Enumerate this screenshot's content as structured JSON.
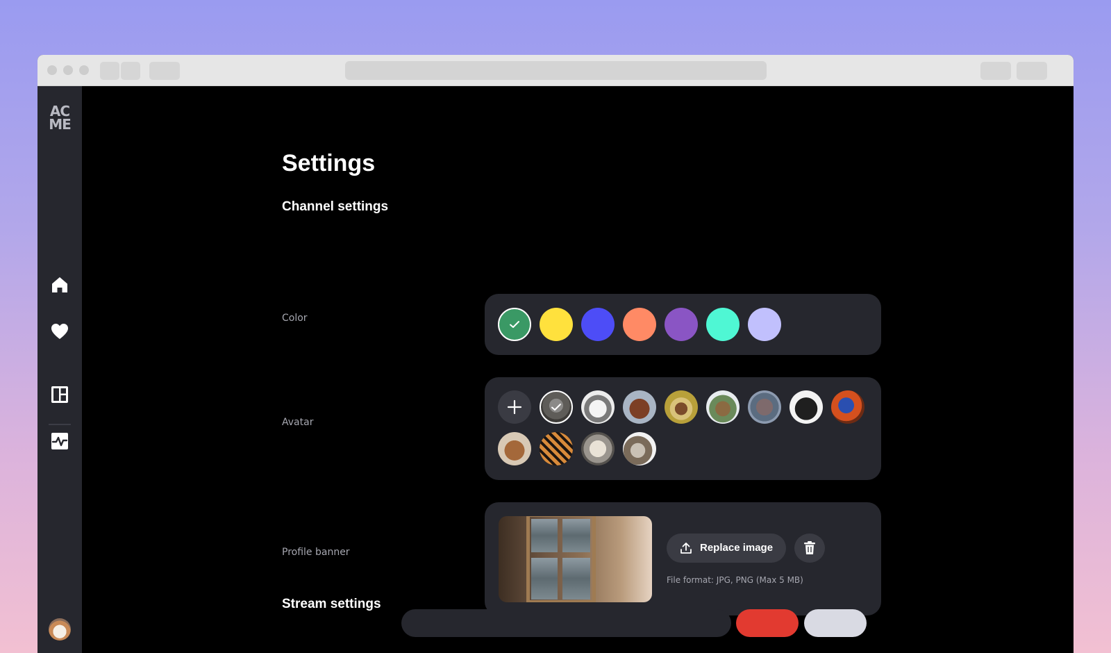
{
  "app": {
    "logo_line1": "AC",
    "logo_line2": "ME"
  },
  "sidebar": {
    "items": [
      {
        "name": "home",
        "icon": "home-icon"
      },
      {
        "name": "favorites",
        "icon": "heart-icon"
      },
      {
        "name": "dashboard",
        "icon": "dashboard-icon"
      },
      {
        "name": "activity",
        "icon": "activity-icon"
      }
    ],
    "user_avatar": "dog-avatar"
  },
  "page": {
    "title": "Settings"
  },
  "channel_settings": {
    "title": "Channel settings",
    "color": {
      "label": "Color",
      "options": [
        "#3a9965",
        "#ffe13d",
        "#4d4df7",
        "#ff8a65",
        "#8a55c4",
        "#4ff7d4",
        "#c1c0fd"
      ],
      "selected_index": 0
    },
    "avatar": {
      "label": "Avatar",
      "options": [
        "cat",
        "dog",
        "horse",
        "antelope",
        "giraffe",
        "hippo",
        "pug",
        "parrot",
        "bear",
        "tiger",
        "sheep",
        "hedgehog"
      ],
      "selected": "cat",
      "add_icon": "plus-icon"
    },
    "profile_banner": {
      "label": "Profile banner",
      "replace_label": "Replace image",
      "file_hint": "File format: JPG, PNG (Max 5 MB)",
      "upload_icon": "upload-icon",
      "delete_icon": "trash-icon"
    }
  },
  "stream_settings": {
    "title": "Stream settings"
  },
  "colors": {
    "sidebar_bg": "#26272e",
    "card_bg": "#26272e",
    "page_bg": "#000000",
    "label_text": "#a6a7b0",
    "danger": "#e23a30"
  }
}
